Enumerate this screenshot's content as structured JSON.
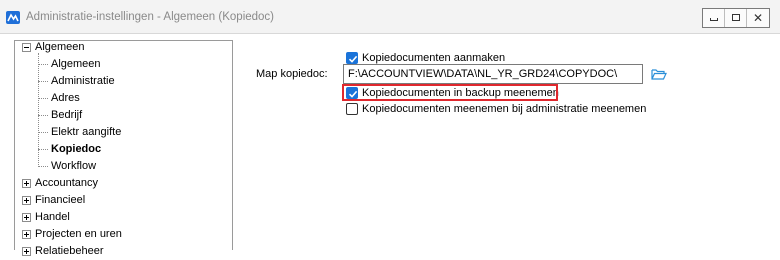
{
  "window": {
    "title": "Administratie-instellingen - Algemeen (Kopiedoc)",
    "accent": "#1f6fd8"
  },
  "tree": {
    "root": {
      "label": "Algemeen",
      "expanded": true
    },
    "children": [
      {
        "label": "Algemeen"
      },
      {
        "label": "Administratie"
      },
      {
        "label": "Adres"
      },
      {
        "label": "Bedrijf"
      },
      {
        "label": "Elektr aangifte"
      },
      {
        "label": "Kopiedoc",
        "selected": true
      },
      {
        "label": "Workflow"
      }
    ],
    "groups": [
      {
        "label": "Accountancy",
        "expanded": false
      },
      {
        "label": "Financieel",
        "expanded": false
      },
      {
        "label": "Handel",
        "expanded": false
      },
      {
        "label": "Projecten en uren",
        "expanded": false
      },
      {
        "label": "Relatiebeheer",
        "expanded": false
      }
    ]
  },
  "form": {
    "create_copies": {
      "label": "Kopiedocumenten aanmaken",
      "checked": true
    },
    "map_label": "Map kopiedoc:",
    "map_value": "F:\\ACCOUNTVIEW\\DATA\\NL_YR_GRD24\\COPYDOC\\",
    "include_in_backup": {
      "label": "Kopiedocumenten in backup meenemen",
      "checked": true
    },
    "include_with_admin": {
      "label": "Kopiedocumenten meenemen bij administratie meenemen",
      "checked": false
    },
    "folder_icon": "folder-open-icon",
    "highlight_color": "#e0282e"
  }
}
